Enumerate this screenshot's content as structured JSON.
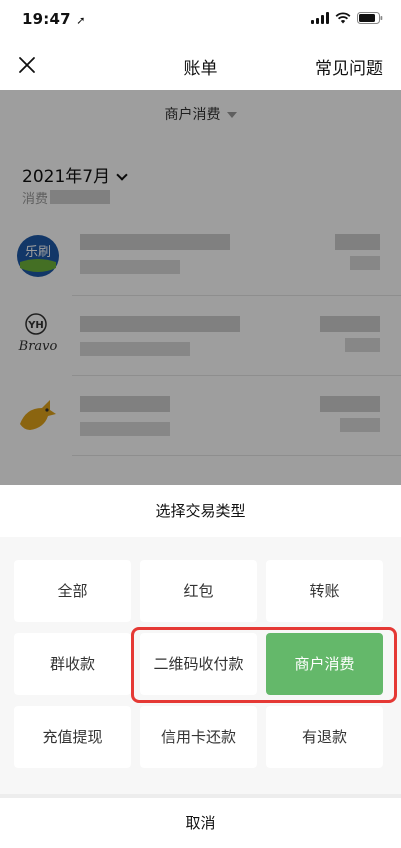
{
  "status_bar": {
    "time": "19:47"
  },
  "nav": {
    "title": "账单",
    "faq_label": "常见问题"
  },
  "filter": {
    "label": "商户消费"
  },
  "month": {
    "label": "2021年7月",
    "sub_label": "消费"
  },
  "transactions": [
    {
      "merchant_logo": "乐刷"
    },
    {
      "merchant_logo": "Bravo"
    },
    {
      "merchant_logo": "kangaroo"
    }
  ],
  "sheet": {
    "title": "选择交易类型",
    "options": [
      "全部",
      "红包",
      "转账",
      "群收款",
      "二维码收付款",
      "商户消费",
      "充值提现",
      "信用卡还款",
      "有退款"
    ],
    "selected": "商户消费",
    "cancel_label": "取消"
  },
  "colors": {
    "selected": "#64b86a",
    "highlight": "#e53935"
  }
}
